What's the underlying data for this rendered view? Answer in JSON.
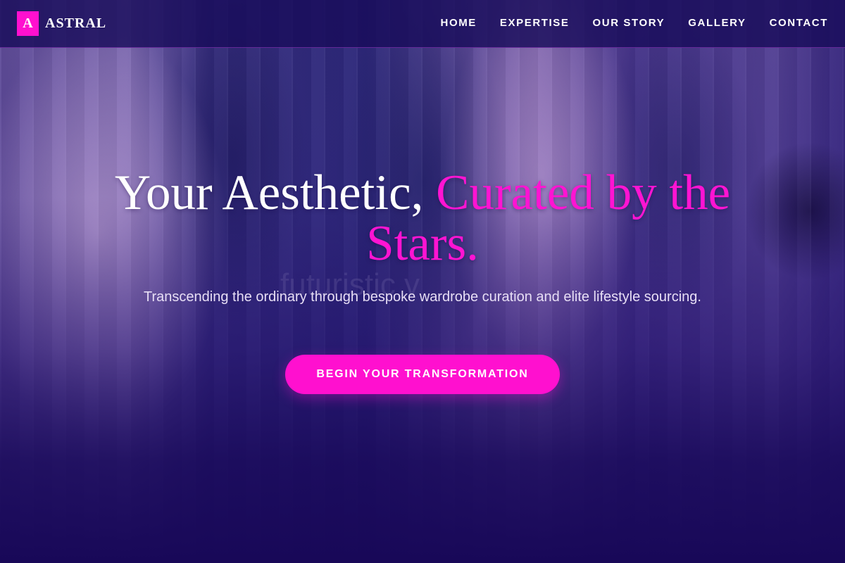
{
  "brand": {
    "logo_letter": "A",
    "name": "ASTRAL"
  },
  "nav": {
    "items": [
      "HOME",
      "EXPERTISE",
      "OUR STORY",
      "GALLERY",
      "CONTACT"
    ]
  },
  "hero": {
    "title_main": "Your Aesthetic, ",
    "title_accent": "Curated by the Stars.",
    "watermark": "futuristic v",
    "subtitle": "Transcending the ordinary through bespoke wardrobe curation and elite lifestyle sourcing.",
    "cta_label": "BEGIN YOUR TRANSFORMATION"
  },
  "colors": {
    "accent": "#ff10cf",
    "header_bg": "#180c5a",
    "base_bg": "#1a0a5c",
    "text": "#ffffff"
  }
}
